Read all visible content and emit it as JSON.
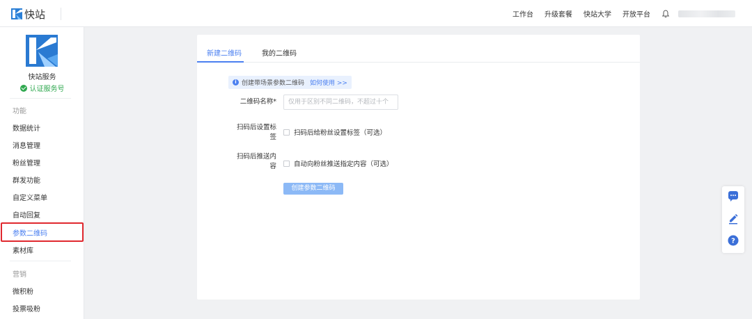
{
  "topbar": {
    "logo_text": "快站",
    "nav": [
      "工作台",
      "升级套餐",
      "快站大学",
      "开放平台"
    ]
  },
  "sidebar": {
    "account_name": "快站服务",
    "verified_label": "认证服务号",
    "section_function": "功能",
    "function_items": [
      "数据统计",
      "消息管理",
      "粉丝管理",
      "群发功能",
      "自定义菜单",
      "自动回复",
      "参数二维码",
      "素材库"
    ],
    "active_item": "参数二维码",
    "section_marketing": "营销",
    "marketing_items": [
      "微积粉",
      "投票吸粉"
    ]
  },
  "main": {
    "tabs": [
      "新建二维码",
      "我的二维码"
    ],
    "active_tab": "新建二维码",
    "hint_text": "创建带场景参数二维码",
    "hint_link": "如何使用 >>",
    "name_label": "二维码名称*",
    "name_placeholder": "仅用于区别不同二维码，不超过十个",
    "tag_label_line1": "扫码后设置标",
    "tag_label_line2": "签",
    "tag_option": "扫码后给粉丝设置标签（可选）",
    "push_label_line1": "扫码后推送内",
    "push_label_line2": "容",
    "push_option": "自动向粉丝推送指定内容（可选）",
    "create_button": "创建参数二维码"
  },
  "colors": {
    "accent": "#4a7ff0",
    "verified": "#2fa84f",
    "highlight_border": "#e0282e",
    "button_disabled": "#8cb9f6",
    "page_bg": "#f0f1f3"
  },
  "icons": [
    "logo-k-icon",
    "bell-icon",
    "check-circle-icon",
    "info-icon",
    "chat-icon",
    "edit-icon",
    "help-icon"
  ]
}
